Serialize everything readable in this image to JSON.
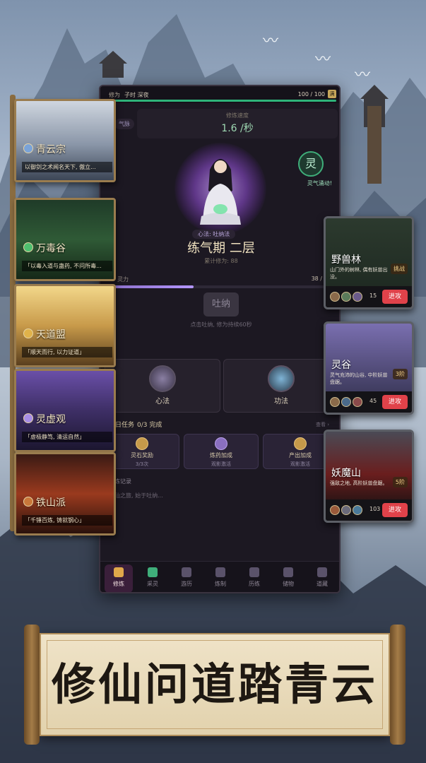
{
  "topbar": {
    "label": "修为",
    "time": "子时 深夜",
    "stamina": "100 / 100",
    "tag": "满",
    "stamina_fraction": 1.0
  },
  "cultivation": {
    "speed_label": "修炼速度",
    "speed_value": "1.6 /秒",
    "qi_tag": "气脉",
    "spirit_button": "灵",
    "spirit_label": "灵气涌动!",
    "method": "心法: 吐纳法",
    "realm": "练气期 二层",
    "cumulative": "累计修为: 88",
    "progress_label": "灵力",
    "progress_value": "38 /",
    "progress_fraction": 0.38,
    "breath_button": "吐纳",
    "breath_hint": "点击吐纳, 修为持续60秒"
  },
  "cards": [
    {
      "label": "心法"
    },
    {
      "label": "功法"
    }
  ],
  "daily": {
    "title": "每日任务",
    "count": "0/3 完成",
    "view_all": "查看 ›",
    "tasks": [
      {
        "name": "灵石奖励",
        "status": "3/3次"
      },
      {
        "name": "炼药加成",
        "status": "观影激活"
      },
      {
        "name": "产出加成",
        "status": "观影激活"
      }
    ]
  },
  "log": {
    "title": "修炼记录",
    "line": "修仙之旅, 始于吐纳..."
  },
  "nav": [
    {
      "label": "修炼",
      "active": true
    },
    {
      "label": "采灵",
      "active": false
    },
    {
      "label": "游历",
      "active": false
    },
    {
      "label": "炼制",
      "active": false
    },
    {
      "label": "历练",
      "active": false
    },
    {
      "label": "储物",
      "active": false
    },
    {
      "label": "道藏",
      "active": false
    }
  ],
  "sects": [
    {
      "name": "青云宗",
      "desc": "以御剑之术闻名天下, 傲立..."
    },
    {
      "name": "万毒谷",
      "desc": "「以毒入道与蛊药, 不问所毒..."
    },
    {
      "name": "天道盟",
      "desc": "「顺天而行, 以力证道」"
    },
    {
      "name": "灵虚观",
      "desc": "「虚极静笃, 清运自然」"
    },
    {
      "name": "铁山派",
      "desc": "「千锤百炼, 铸就钢心」"
    }
  ],
  "battles": [
    {
      "name": "野兽林",
      "level": "挑战",
      "desc": "山门外的树林, 偶有妖兽出没。",
      "count": "15",
      "button": "进攻"
    },
    {
      "name": "灵谷",
      "level": "3阶",
      "desc": "灵气充沛的山谷, 中阶妖兽盘踞。",
      "count": "45",
      "button": "进攻"
    },
    {
      "name": "妖魔山",
      "level": "5阶",
      "desc": "强敌之地, 高阶妖兽盘踞。",
      "count": "103",
      "button": "进攻"
    }
  ],
  "banner": {
    "slogan": "修仙问道踏青云"
  },
  "colors": {
    "accent_green": "#2fb37a",
    "attack_red": "#e0424a",
    "purple": "#b496ff",
    "gold": "#c6a65a"
  }
}
